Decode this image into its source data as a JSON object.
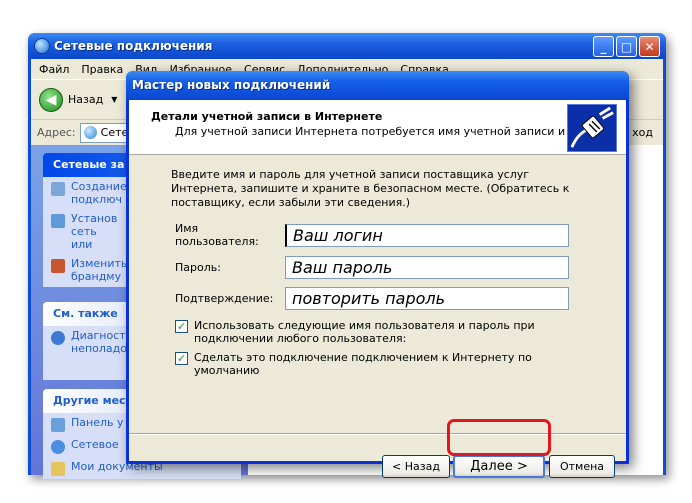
{
  "back_window": {
    "title": "Сетевые подключения",
    "menu": [
      "Файл",
      "Правка",
      "Вид",
      "Избранное",
      "Сервис",
      "Дополнительно",
      "Справка"
    ],
    "back_label": "Назад",
    "address_label": "Адрес:",
    "address_value": "Сете",
    "go_label": "ход",
    "panels": [
      {
        "title": "Сетевые за",
        "items": [
          "Создание подключ",
          "Установ сеть или",
          "Изменить брандму"
        ]
      },
      {
        "title": "См. также",
        "items": [
          "Диагност неполадо"
        ]
      },
      {
        "title": "Другие мест",
        "items": [
          "Панель у",
          "Сетевое",
          "Мои документы"
        ]
      }
    ]
  },
  "wizard": {
    "title": "Мастер новых подключений",
    "header_title": "Детали учетной записи в Интернете",
    "header_subtitle": "Для учетной записи Интернета потребуется имя учетной записи и пароль.",
    "intro": "Введите имя и пароль для учетной записи поставщика услуг Интернета, запишите и храните в безопасном месте. (Обратитесь к поставщику, если забыли эти сведения.)",
    "fields": [
      {
        "label": "Имя пользователя:",
        "value": "Ваш логин"
      },
      {
        "label": "Пароль:",
        "value": "Ваш пароль"
      },
      {
        "label": "Подтверждение:",
        "value": "повторить пароль"
      }
    ],
    "checkboxes": [
      {
        "label": "Использовать следующие имя пользователя и пароль при подключении любого пользователя:",
        "checked": true
      },
      {
        "label": "Сделать это подключение подключением к Интернету по умолчанию",
        "checked": true
      }
    ],
    "buttons": {
      "back": "< Назад",
      "next": "Далее >",
      "cancel": "Отмена"
    }
  },
  "colors": {
    "highlight": "#e0171c",
    "titlebar": "#0a46d0"
  }
}
